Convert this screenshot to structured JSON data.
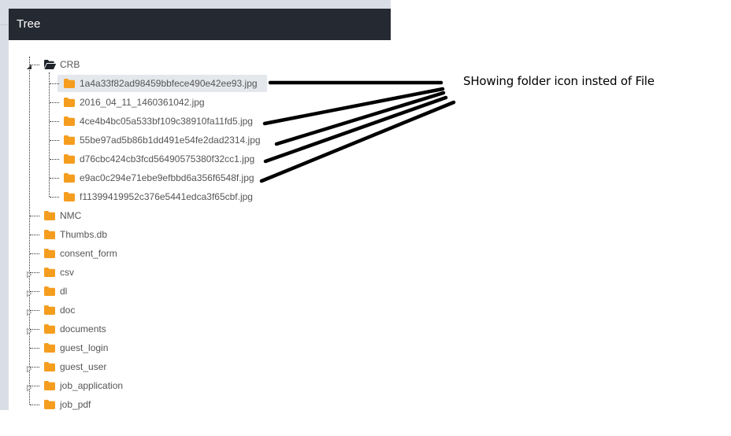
{
  "panel": {
    "title": "Tree"
  },
  "tree": {
    "root": {
      "label": "CRB",
      "expanded": true,
      "icon": "folder-open-icon",
      "children": [
        {
          "label": "1a4a33f82ad98459bbfece490e42ee93.jpg",
          "icon": "folder-icon",
          "selected": true
        },
        {
          "label": "2016_04_11_1460361042.jpg",
          "icon": "folder-icon"
        },
        {
          "label": "4ce4b4bc05a533bf109c38910fa11fd5.jpg",
          "icon": "folder-icon"
        },
        {
          "label": "55be97ad5b86b1dd491e54fe2dad2314.jpg",
          "icon": "folder-icon"
        },
        {
          "label": "d76cbc424cb3fcd56490575380f32cc1.jpg",
          "icon": "folder-icon"
        },
        {
          "label": "e9ac0c294e71ebe9efbbd6a356f6548f.jpg",
          "icon": "folder-icon"
        },
        {
          "label": "f11399419952c376e5441edca3f65cbf.jpg",
          "icon": "folder-icon"
        }
      ]
    },
    "siblings": [
      {
        "label": "NMC",
        "has_children": false
      },
      {
        "label": "Thumbs.db",
        "has_children": false
      },
      {
        "label": "consent_form",
        "has_children": false
      },
      {
        "label": "csv",
        "has_children": true
      },
      {
        "label": "dl",
        "has_children": true
      },
      {
        "label": "doc",
        "has_children": true
      },
      {
        "label": "documents",
        "has_children": true
      },
      {
        "label": "guest_login",
        "has_children": false
      },
      {
        "label": "guest_user",
        "has_children": true
      },
      {
        "label": "job_application",
        "has_children": true
      },
      {
        "label": "job_pdf",
        "has_children": false
      }
    ]
  },
  "annotation": {
    "text": "SHowing folder icon insted of File"
  },
  "colors": {
    "header_bg": "#252931",
    "folder_orange": "#f59d1f",
    "folder_open_dark": "#1f242b",
    "selected_bg": "#e4e7eb",
    "label_text": "#555555"
  }
}
